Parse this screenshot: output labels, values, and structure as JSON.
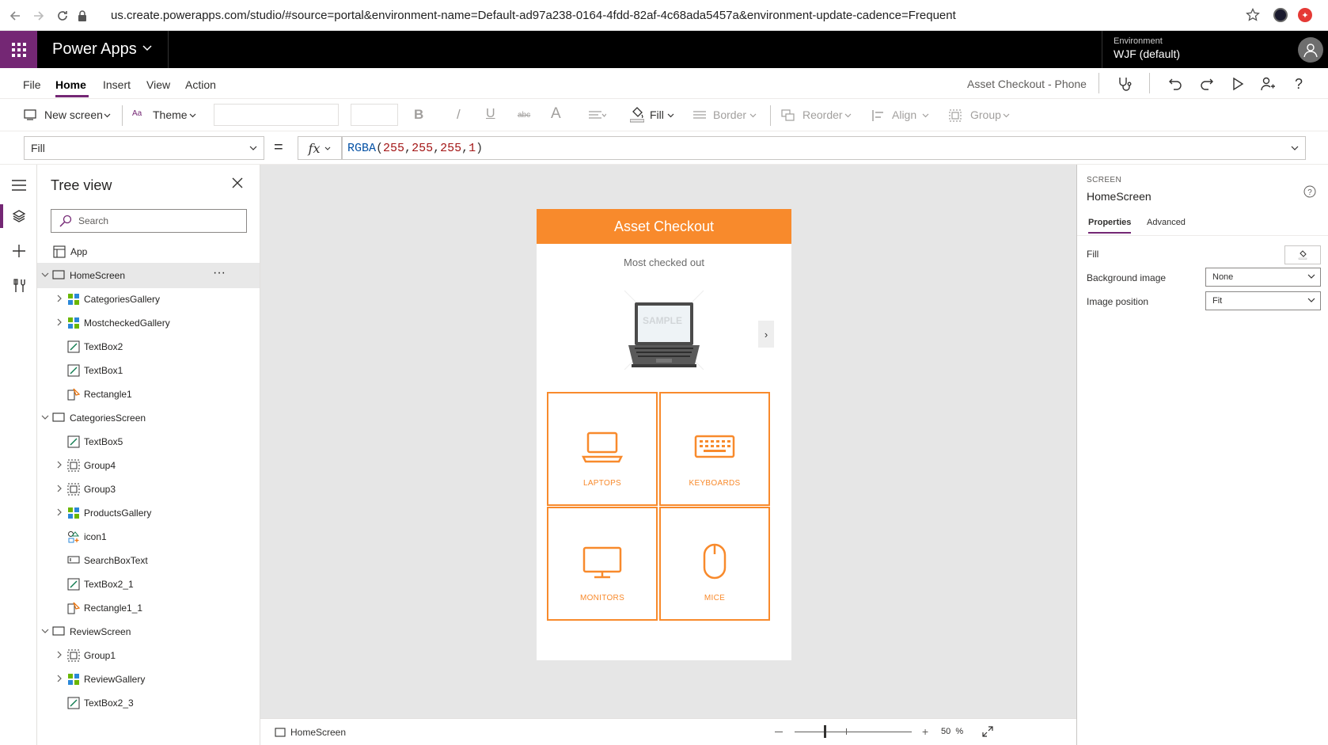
{
  "browser": {
    "url": "us.create.powerapps.com/studio/#source=portal&environment-name=Default-ad97a238-0164-4fdd-82af-4c68ada5457a&environment-update-cadence=Frequent"
  },
  "header": {
    "app_name": "Power Apps",
    "environment_label": "Environment",
    "environment_name": "WJF (default)"
  },
  "menu": {
    "items": [
      "File",
      "Home",
      "Insert",
      "View",
      "Action"
    ],
    "active": "Home",
    "doc_title": "Asset Checkout - Phone"
  },
  "toolbar": {
    "new_screen": "New screen",
    "theme": "Theme",
    "bold": "B",
    "italic": "/",
    "underline": "U",
    "strike": "abc",
    "font_size_glyph": "A",
    "fill": "Fill",
    "border": "Border",
    "reorder": "Reorder",
    "align": "Align",
    "group": "Group"
  },
  "formula": {
    "property": "Fill",
    "equals": "=",
    "fx": "fx",
    "fn": "RGBA",
    "open": "(",
    "args": [
      "255",
      "255",
      "255",
      "1"
    ],
    "close": ")"
  },
  "tree": {
    "title": "Tree view",
    "search_placeholder": "Search",
    "app_label": "App",
    "nodes": [
      {
        "label": "HomeScreen",
        "type": "screen"
      },
      {
        "label": "CategoriesGallery",
        "type": "gallery"
      },
      {
        "label": "MostcheckedGallery",
        "type": "gallery"
      },
      {
        "label": "TextBox2",
        "type": "text"
      },
      {
        "label": "TextBox1",
        "type": "text"
      },
      {
        "label": "Rectangle1",
        "type": "shape"
      },
      {
        "label": "CategoriesScreen",
        "type": "screen"
      },
      {
        "label": "TextBox5",
        "type": "text"
      },
      {
        "label": "Group4",
        "type": "group"
      },
      {
        "label": "Group3",
        "type": "group"
      },
      {
        "label": "ProductsGallery",
        "type": "gallery"
      },
      {
        "label": "icon1",
        "type": "icon"
      },
      {
        "label": "SearchBoxText",
        "type": "input"
      },
      {
        "label": "TextBox2_1",
        "type": "text"
      },
      {
        "label": "Rectangle1_1",
        "type": "shape"
      },
      {
        "label": "ReviewScreen",
        "type": "screen"
      },
      {
        "label": "Group1",
        "type": "group"
      },
      {
        "label": "ReviewGallery",
        "type": "gallery"
      },
      {
        "label": "TextBox2_3",
        "type": "text"
      }
    ],
    "more": "···"
  },
  "app_preview": {
    "header": "Asset Checkout",
    "subtitle": "Most checked out",
    "image_overlay_text": "SAMPLE",
    "tiles": [
      "LAPTOPS",
      "KEYBOARDS",
      "MONITORS",
      "MICE"
    ],
    "accent": "#f88a2c"
  },
  "status": {
    "screen": "HomeScreen",
    "zoom_value": "50",
    "zoom_unit": "%"
  },
  "properties": {
    "type": "SCREEN",
    "name": "HomeScreen",
    "tabs": [
      "Properties",
      "Advanced"
    ],
    "fill_label": "Fill",
    "background_image_label": "Background image",
    "background_image_value": "None",
    "image_position_label": "Image position",
    "image_position_value": "Fit"
  },
  "colors": {
    "brand": "#742774",
    "accent": "#f88a2c"
  }
}
